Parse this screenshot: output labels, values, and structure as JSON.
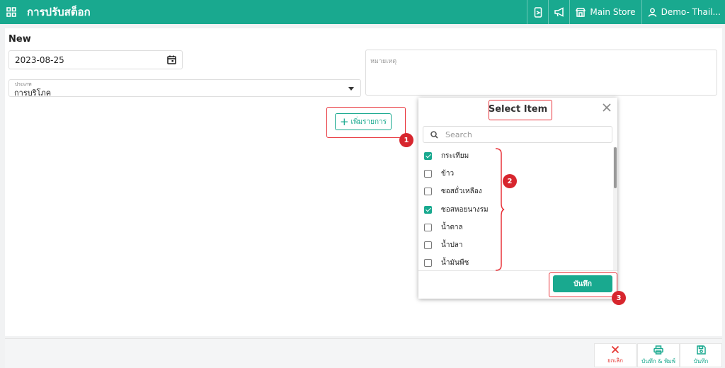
{
  "header": {
    "title": "การปรับสต็อก",
    "store": "Main Store",
    "user": "Demo- Thail..."
  },
  "form": {
    "heading": "New",
    "date": "2023-08-25",
    "type_label": "ประเภท",
    "type_value": "การบริโภค",
    "note_placeholder": "หมายเหตุ",
    "add_item_label": "เพิ่มรายการ"
  },
  "modal": {
    "title": "Select Item",
    "search_placeholder": "Search",
    "items": [
      {
        "label": "กระเทียม",
        "checked": true
      },
      {
        "label": "ข้าว",
        "checked": false
      },
      {
        "label": "ซอสถั่วเหลือง",
        "checked": false
      },
      {
        "label": "ซอสหอยนางรม",
        "checked": true
      },
      {
        "label": "น้ำตาล",
        "checked": false
      },
      {
        "label": "น้ำปลา",
        "checked": false
      },
      {
        "label": "น้ำมันพืช",
        "checked": false
      }
    ],
    "save_label": "บันทึก"
  },
  "annotations": {
    "badge1": "1",
    "badge2": "2",
    "badge3": "3",
    "color": "#e8333a"
  },
  "footer": {
    "cancel_label": "ยกเลิก",
    "save_print_label": "บันทึก & พิมพ์",
    "save_label": "บันทึก"
  },
  "colors": {
    "primary": "#19a98f",
    "danger": "#e53935",
    "badge": "#d7262e"
  },
  "icons": {
    "apps": "grid-icon",
    "device": "phone-icon",
    "announce": "megaphone-icon",
    "store": "store-icon",
    "user": "user-icon",
    "calendar": "calendar-icon",
    "search": "search-icon",
    "close": "close-icon",
    "cancel": "x-icon",
    "print": "printer-icon",
    "save": "floppy-icon"
  }
}
